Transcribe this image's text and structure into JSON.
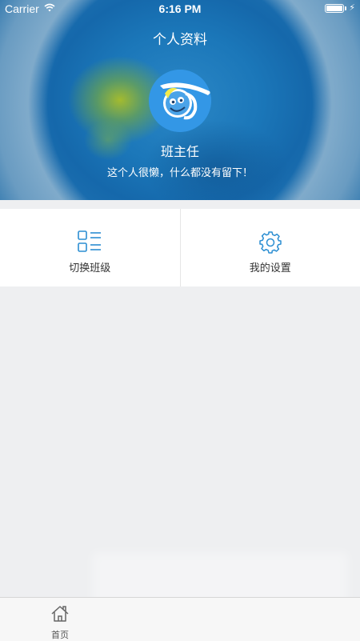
{
  "status_bar": {
    "carrier": "Carrier",
    "time": "6:16 PM",
    "battery_level": 1.0
  },
  "header": {
    "title": "个人资料",
    "avatar_icon": "cartoon-face-logo-icon",
    "name": "班主任",
    "bio": "这个人很懒，什么都没有留下！"
  },
  "actions": [
    {
      "label": "切换班级",
      "icon": "grid-list-icon"
    },
    {
      "label": "我的设置",
      "icon": "gear-icon"
    }
  ],
  "tabbar": {
    "items": [
      {
        "label": "首页",
        "icon": "home-icon"
      }
    ]
  },
  "colors": {
    "accent": "#2b8ed2",
    "header_bg": "#1a7fc4",
    "page_bg": "#eeeff1"
  }
}
